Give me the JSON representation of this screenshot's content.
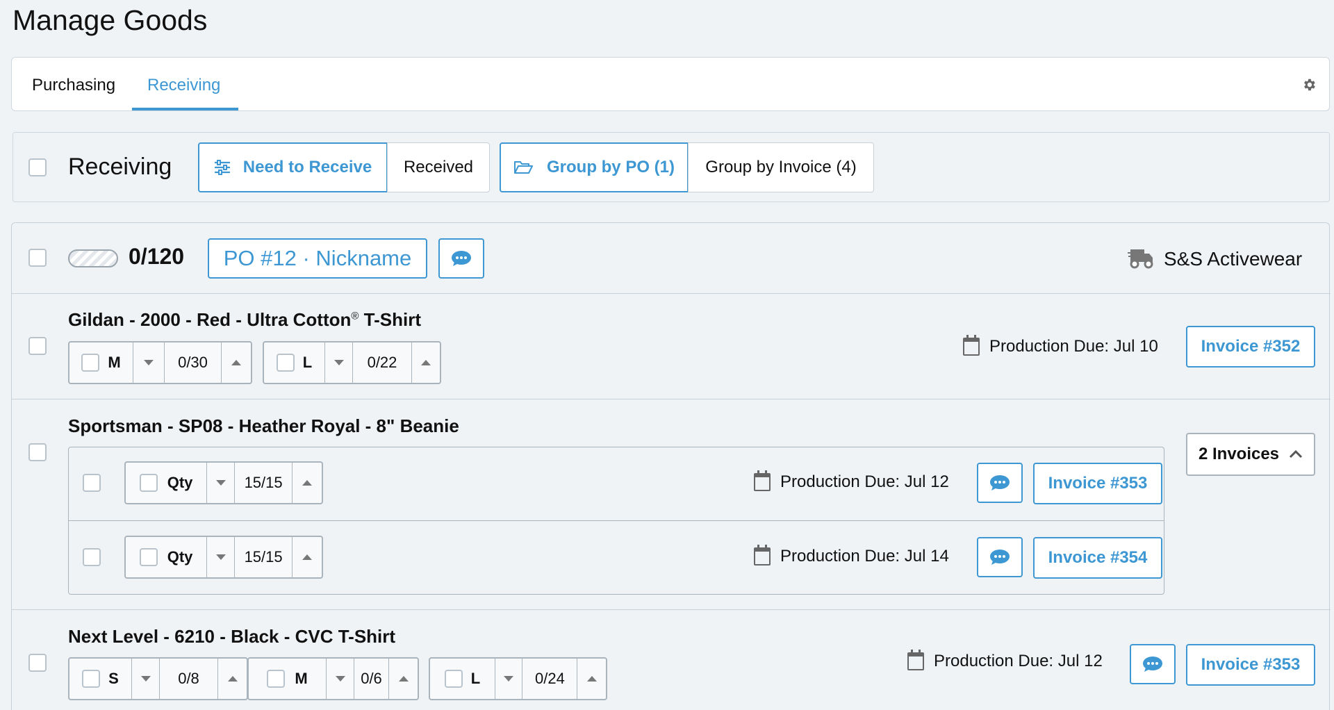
{
  "page": {
    "title": "Manage Goods"
  },
  "tabs": [
    {
      "label": "Purchasing"
    },
    {
      "label": "Receiving",
      "active": true
    }
  ],
  "toolbar": {
    "heading": "Receiving",
    "need_to_receive": "Need to Receive",
    "received": "Received",
    "group_by_po": "Group by PO (1)",
    "group_by_invoice": "Group by Invoice (4)"
  },
  "po": {
    "progress": "0/120",
    "progress_fraction": 0,
    "label": "PO #12 · Nickname",
    "vendor": "S&S Activewear"
  },
  "items": [
    {
      "title": "Gildan - 2000 - Red - Ultra Cotton",
      "title_suffix": "®",
      "title_end": " T-Shirt",
      "sizes": [
        {
          "size": "M",
          "count": "0/30"
        },
        {
          "size": "L",
          "count": "0/22"
        }
      ],
      "due": "Production Due: Jul 10",
      "invoice": "Invoice #352"
    },
    {
      "title": "Sportsman - SP08 - Heather Royal - 8\" Beanie",
      "invoices_toggle": "2 Invoices",
      "subrows": [
        {
          "size": "Qty",
          "count": "15/15",
          "due": "Production Due: Jul 12",
          "invoice": "Invoice #353"
        },
        {
          "size": "Qty",
          "count": "15/15",
          "due": "Production Due: Jul 14",
          "invoice": "Invoice #354"
        }
      ]
    },
    {
      "title": "Next Level - 6210 - Black - CVC T-Shirt",
      "sizes": [
        {
          "size": "S",
          "count": "0/8"
        },
        {
          "size": "M",
          "count": "0/6"
        },
        {
          "size": "L",
          "count": "0/24"
        }
      ],
      "due": "Production Due: Jul 12",
      "invoice": "Invoice #353"
    }
  ],
  "colors": {
    "accent": "#3d97d3",
    "border": "#c8d0d8",
    "background": "#f0f3f6"
  }
}
